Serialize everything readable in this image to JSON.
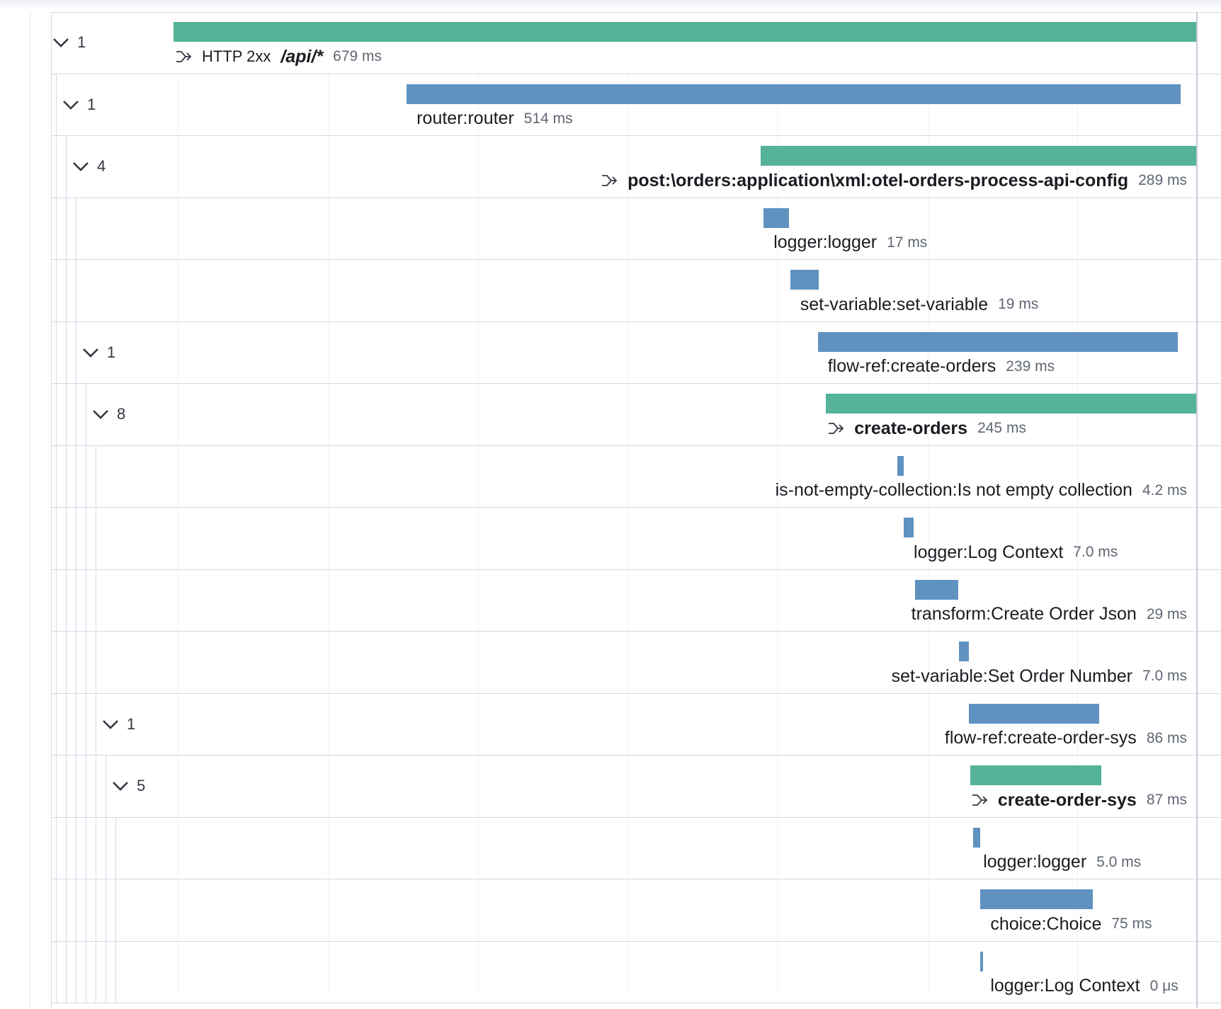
{
  "colors": {
    "transaction": "#54b399",
    "span": "#6092c0"
  },
  "total_duration_ms": 679,
  "rows": [
    {
      "kind": "transaction",
      "toggle_count": "1",
      "status": "HTTP 2xx",
      "name": "/api/*",
      "duration": "679 ms",
      "start_fraction": 0.0,
      "duration_fraction": 1.0
    },
    {
      "kind": "span",
      "toggle_count": "1",
      "name": "router:router",
      "duration": "514 ms",
      "start_fraction": 0.228,
      "duration_fraction": 0.757
    },
    {
      "kind": "transaction",
      "toggle_count": "4",
      "name": "post:\\orders:application\\xml:otel-orders-process-api-config",
      "duration": "289 ms",
      "start_fraction": 0.574,
      "duration_fraction": 0.426
    },
    {
      "kind": "span",
      "toggle_count": "",
      "name": "logger:logger",
      "duration": "17 ms",
      "start_fraction": 0.577,
      "duration_fraction": 0.025
    },
    {
      "kind": "span",
      "toggle_count": "",
      "name": "set-variable:set-variable",
      "duration": "19 ms",
      "start_fraction": 0.603,
      "duration_fraction": 0.028
    },
    {
      "kind": "span",
      "toggle_count": "1",
      "name": "flow-ref:create-orders",
      "duration": "239 ms",
      "start_fraction": 0.63,
      "duration_fraction": 0.352
    },
    {
      "kind": "transaction",
      "toggle_count": "8",
      "name": "create-orders",
      "duration": "245 ms",
      "start_fraction": 0.638,
      "duration_fraction": 0.362
    },
    {
      "kind": "span",
      "toggle_count": "",
      "name": "is-not-empty-collection:Is not empty collection",
      "duration": "4.2 ms",
      "start_fraction": 0.708,
      "duration_fraction": 0.006
    },
    {
      "kind": "span",
      "toggle_count": "",
      "name": "logger:Log Context",
      "duration": "7.0 ms",
      "start_fraction": 0.714,
      "duration_fraction": 0.01
    },
    {
      "kind": "span",
      "toggle_count": "",
      "name": "transform:Create Order Json",
      "duration": "29 ms",
      "start_fraction": 0.725,
      "duration_fraction": 0.042
    },
    {
      "kind": "span",
      "toggle_count": "",
      "name": "set-variable:Set Order Number",
      "duration": "7.0 ms",
      "start_fraction": 0.768,
      "duration_fraction": 0.01
    },
    {
      "kind": "span",
      "toggle_count": "1",
      "name": "flow-ref:create-order-sys",
      "duration": "86 ms",
      "start_fraction": 0.778,
      "duration_fraction": 0.127
    },
    {
      "kind": "transaction",
      "toggle_count": "5",
      "name": "create-order-sys",
      "duration": "87 ms",
      "start_fraction": 0.779,
      "duration_fraction": 0.128
    },
    {
      "kind": "span",
      "toggle_count": "",
      "name": "logger:logger",
      "duration": "5.0 ms",
      "start_fraction": 0.782,
      "duration_fraction": 0.007
    },
    {
      "kind": "span",
      "toggle_count": "",
      "name": "choice:Choice",
      "duration": "75 ms",
      "start_fraction": 0.789,
      "duration_fraction": 0.11
    },
    {
      "kind": "span",
      "toggle_count": "",
      "name": "logger:Log Context",
      "duration": "0 μs",
      "start_fraction": 0.789,
      "duration_fraction": 0.001
    }
  ]
}
